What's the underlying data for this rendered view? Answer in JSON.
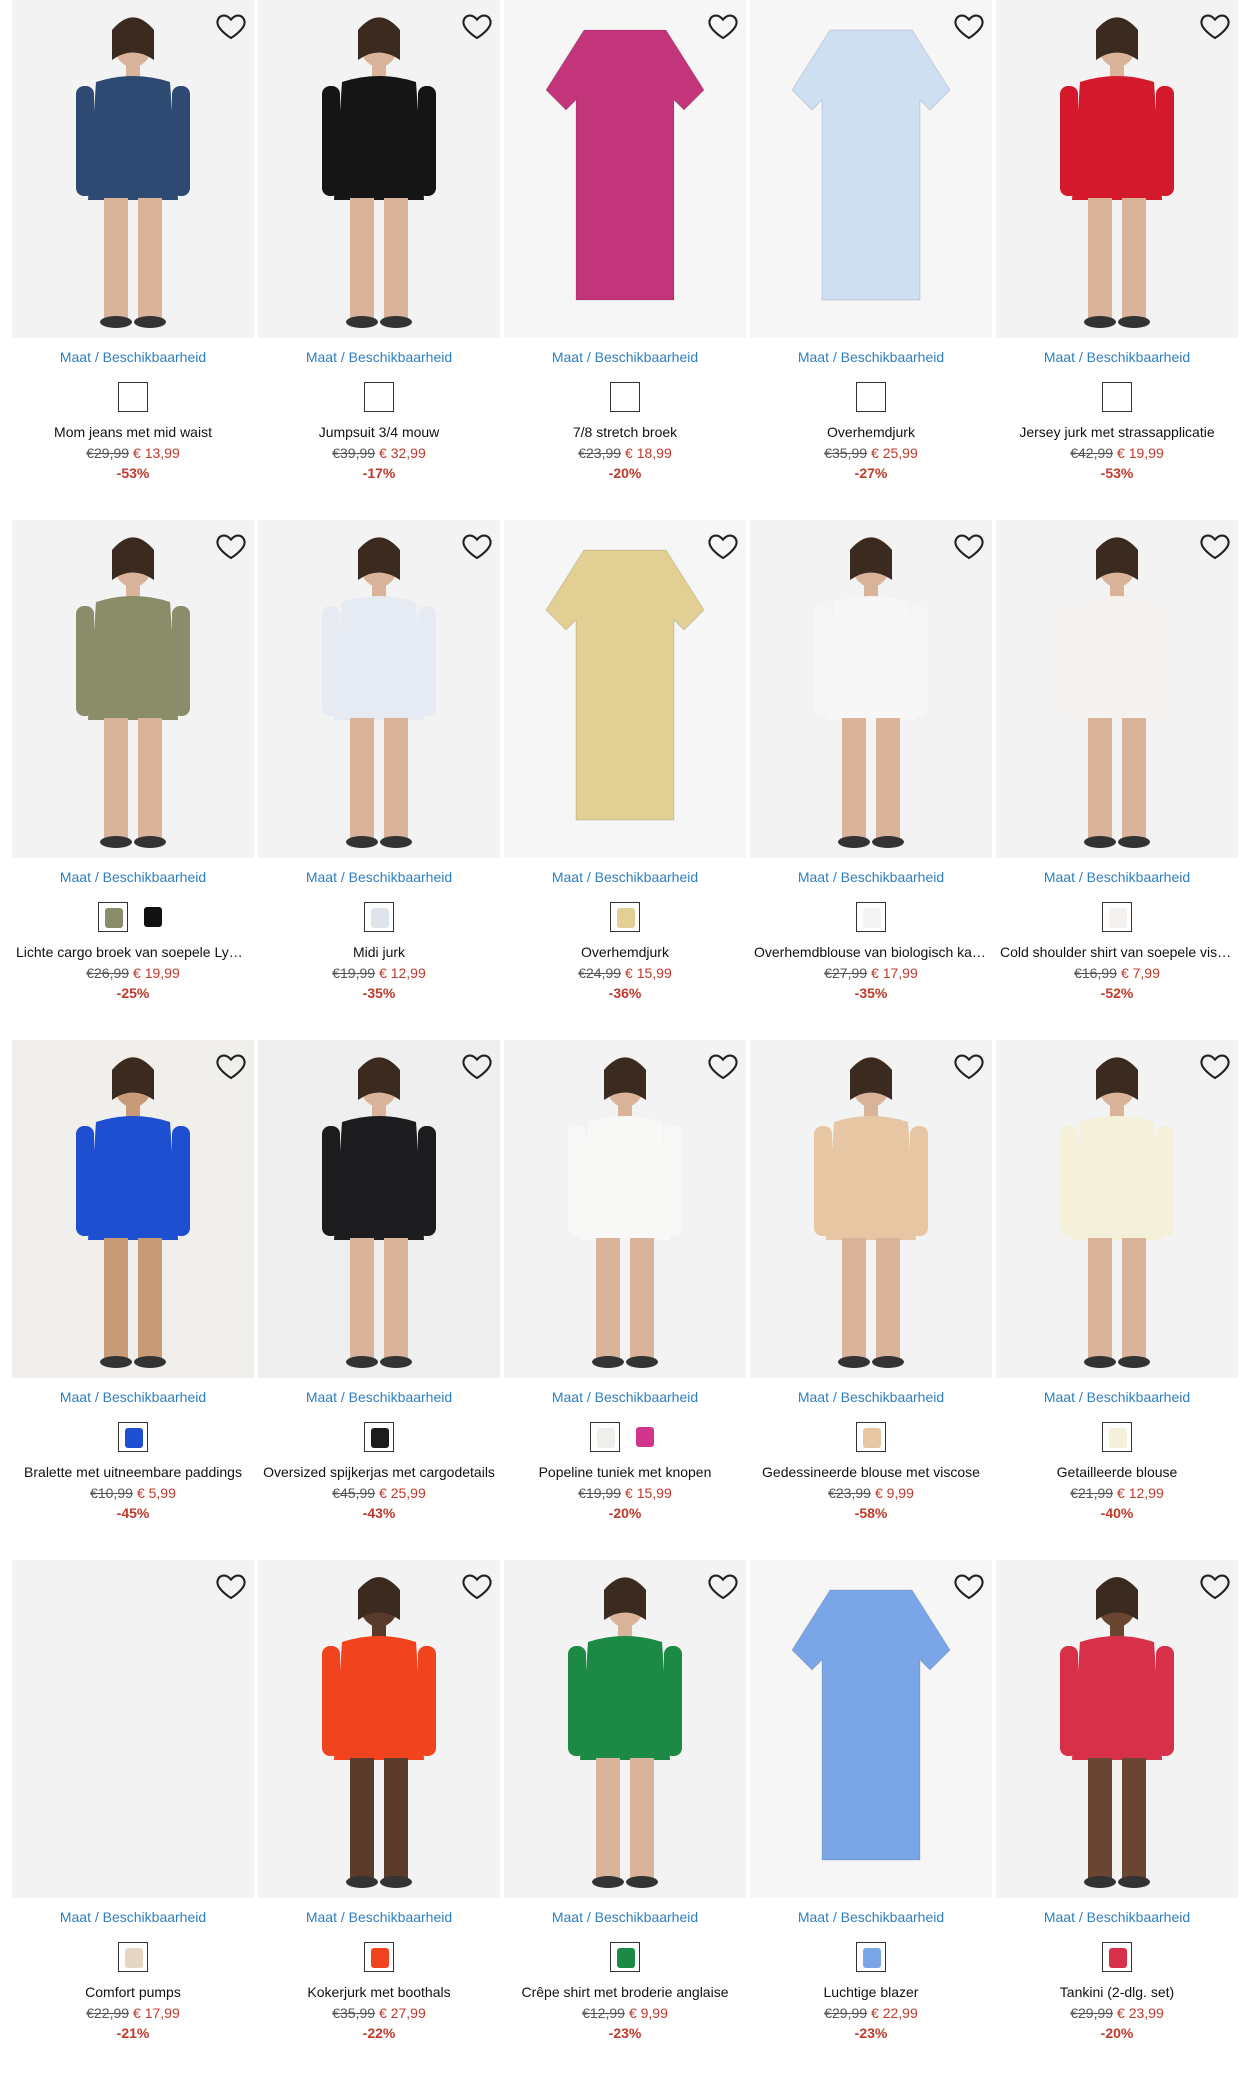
{
  "size_label": "Maat / Beschikbaarheid",
  "products": [
    {
      "name": "Mom jeans met mid waist",
      "old": "€29,99",
      "new": "€ 13,99",
      "disc": "-53%",
      "bg": "#f3f3f3",
      "garment": "#2f4a72",
      "skin": "#d9b49a",
      "swatches": [
        {
          "color": "#ffffff",
          "selected": true
        }
      ]
    },
    {
      "name": "Jumpsuit 3/4 mouw",
      "old": "€39,99",
      "new": "€ 32,99",
      "disc": "-17%",
      "bg": "#f3f3f3",
      "garment": "#151515",
      "skin": "#d9b49a",
      "swatches": [
        {
          "color": "#ffffff",
          "selected": true
        }
      ]
    },
    {
      "name": "7/8 stretch broek",
      "old": "€23,99",
      "new": "€ 18,99",
      "disc": "-20%",
      "bg": "#f6f6f6",
      "garment": "#c2357a",
      "skin": "",
      "swatches": [
        {
          "color": "#ffffff",
          "selected": true
        }
      ]
    },
    {
      "name": "Overhemdjurk",
      "old": "€35,99",
      "new": "€ 25,99",
      "disc": "-27%",
      "bg": "#f6f6f6",
      "garment": "#cfdff2",
      "skin": "",
      "swatches": [
        {
          "color": "#ffffff",
          "selected": true
        }
      ]
    },
    {
      "name": "Jersey jurk met strassapplicatie",
      "old": "€42,99",
      "new": "€ 19,99",
      "disc": "-53%",
      "bg": "#f3f3f3",
      "garment": "#d3192b",
      "skin": "#d9b49a",
      "swatches": [
        {
          "color": "#ffffff",
          "selected": true
        }
      ]
    },
    {
      "name": "Lichte cargo broek van soepele Lyo…",
      "old": "€26,99",
      "new": "€ 19,99",
      "disc": "-25%",
      "bg": "#f3f3f3",
      "garment": "#8a8c6a",
      "skin": "#d9b49a",
      "swatches": [
        {
          "color": "#8a8c6a",
          "selected": true
        },
        {
          "color": "#111111",
          "selected": false
        }
      ]
    },
    {
      "name": "Midi jurk",
      "old": "€19,99",
      "new": "€ 12,99",
      "disc": "-35%",
      "bg": "#f3f3f3",
      "garment": "#e6eaf2",
      "skin": "#d9b49a",
      "swatches": [
        {
          "color": "#dfe3ea",
          "selected": true
        }
      ]
    },
    {
      "name": "Overhemdjurk",
      "old": "€24,99",
      "new": "€ 15,99",
      "disc": "-36%",
      "bg": "#f6f6f6",
      "garment": "#e2cf94",
      "skin": "",
      "swatches": [
        {
          "color": "#e2cf94",
          "selected": true
        }
      ]
    },
    {
      "name": "Overhemdblouse van biologisch kat…",
      "old": "€27,99",
      "new": "€ 17,99",
      "disc": "-35%",
      "bg": "#f3f3f3",
      "garment": "#f7f7f7",
      "skin": "#d9b49a",
      "swatches": [
        {
          "color": "#f4f4f4",
          "selected": true
        }
      ]
    },
    {
      "name": "Cold shoulder shirt van soepele visc…",
      "old": "€16,99",
      "new": "€ 7,99",
      "disc": "-52%",
      "bg": "#f3f3f3",
      "garment": "#f4f1ee",
      "skin": "#d9b49a",
      "swatches": [
        {
          "color": "#f4f1ee",
          "selected": true
        }
      ]
    },
    {
      "name": "Bralette met uitneembare paddings",
      "old": "€10,99",
      "new": "€ 5,99",
      "disc": "-45%",
      "bg": "#f1efec",
      "garment": "#1f4fd1",
      "skin": "#c99a78",
      "swatches": [
        {
          "color": "#1f4fd1",
          "selected": true
        }
      ]
    },
    {
      "name": "Oversized spijkerjas met cargodetails",
      "old": "€45,99",
      "new": "€ 25,99",
      "disc": "-43%",
      "bg": "#efefef",
      "garment": "#1c1c1f",
      "skin": "#d9b49a",
      "swatches": [
        {
          "color": "#1c1c1f",
          "selected": true
        }
      ]
    },
    {
      "name": "Popeline tuniek met knopen",
      "old": "€19,99",
      "new": "€ 15,99",
      "disc": "-20%",
      "bg": "#f3f3f3",
      "garment": "#f8f8f6",
      "skin": "#d9b49a",
      "swatches": [
        {
          "color": "#eeeeea",
          "selected": true
        },
        {
          "color": "#d2348e",
          "selected": false
        }
      ]
    },
    {
      "name": "Gedessineerde blouse met viscose",
      "old": "€23,99",
      "new": "€ 9,99",
      "disc": "-58%",
      "bg": "#f3f3f3",
      "garment": "#e7c7a3",
      "skin": "#d9b49a",
      "swatches": [
        {
          "color": "#e7c7a3",
          "selected": true
        }
      ]
    },
    {
      "name": "Getailleerde blouse",
      "old": "€21,99",
      "new": "€ 12,99",
      "disc": "-40%",
      "bg": "#f3f3f3",
      "garment": "#f4f0da",
      "skin": "#d9b49a",
      "swatches": [
        {
          "color": "#f4f0da",
          "selected": true
        }
      ]
    },
    {
      "name": "Comfort pumps",
      "old": "€22,99",
      "new": "€ 17,99",
      "disc": "-21%",
      "bg": "#f3f3f3",
      "garment": "",
      "skin": "",
      "swatches": [
        {
          "color": "#e6d6c4",
          "selected": true
        }
      ]
    },
    {
      "name": "Kokerjurk met boothals",
      "old": "€35,99",
      "new": "€ 27,99",
      "disc": "-22%",
      "bg": "#f3f3f3",
      "garment": "#f2431f",
      "skin": "#5a3a2a",
      "swatches": [
        {
          "color": "#f2431f",
          "selected": true
        }
      ]
    },
    {
      "name": "Crêpe shirt met broderie anglaise",
      "old": "€12,99",
      "new": "€ 9,99",
      "disc": "-23%",
      "bg": "#f3f3f3",
      "garment": "#1c8a45",
      "skin": "#d9b49a",
      "swatches": [
        {
          "color": "#1c8a45",
          "selected": true
        }
      ]
    },
    {
      "name": "Luchtige blazer",
      "old": "€29,99",
      "new": "€ 22,99",
      "disc": "-23%",
      "bg": "#f6f6f6",
      "garment": "#7aa5e6",
      "skin": "",
      "swatches": [
        {
          "color": "#7aa5e6",
          "selected": true
        }
      ]
    },
    {
      "name": "Tankini (2-dlg. set)",
      "old": "€29,99",
      "new": "€ 23,99",
      "disc": "-20%",
      "bg": "#f3f3f3",
      "garment": "#d9304a",
      "skin": "#6a4532",
      "swatches": [
        {
          "color": "#d9304a",
          "selected": true
        }
      ]
    }
  ]
}
